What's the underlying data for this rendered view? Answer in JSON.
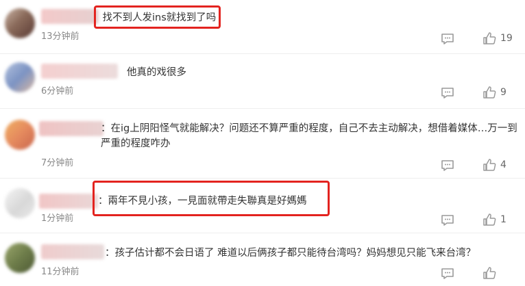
{
  "comments": [
    {
      "text": "：找不到人发ins就找到了吗",
      "time": "13分钟前",
      "likes": "19",
      "avatar_colors": [
        "#8a6a5a",
        "#c9b3a4",
        "#5a3b35"
      ],
      "name_colors": [
        "#f3c9c9",
        "#e6d0d0"
      ]
    },
    {
      "text": "他真的戏很多",
      "time": "6分钟前",
      "likes": "9",
      "avatar_colors": [
        "#7c93c3",
        "#b3c2de",
        "#d9b9a5"
      ],
      "name_colors": [
        "#f4cfcf",
        "#ecdcdc"
      ]
    },
    {
      "text": "：在ig上阴阳怪气就能解决？问题还不算严重的程度，自己不去主动解决，想借着媒体…万一到严重的程度咋办",
      "time": "7分钟前",
      "likes": "4",
      "avatar_colors": [
        "#f0b063",
        "#e58a5e",
        "#c9664d"
      ],
      "name_colors": [
        "#efc3c3",
        "#e9d2d2"
      ]
    },
    {
      "text": "：兩年不見小孩，一見面就帶走失聯真是好媽媽",
      "time": "1分钟前",
      "likes": "1",
      "avatar_colors": [
        "#e9e9e9",
        "#d8d8d8",
        "#f4f4f4"
      ],
      "name_colors": [
        "#f1c6c6",
        "#ead7d7"
      ]
    },
    {
      "text": "：孩子估计都不会日语了 难道以后俩孩子都只能待台湾吗？妈妈想见只能飞来台湾？",
      "time": "11分钟前",
      "likes": "",
      "avatar_colors": [
        "#6e7d4a",
        "#9aa66c",
        "#4e5a35"
      ],
      "name_colors": [
        "#efcccc",
        "#e8dada"
      ]
    }
  ],
  "colors": {
    "highlight": "#e3231f",
    "meta": "#888888"
  },
  "icons": {
    "reply": "comment-icon",
    "like": "thumbs-up-icon"
  }
}
